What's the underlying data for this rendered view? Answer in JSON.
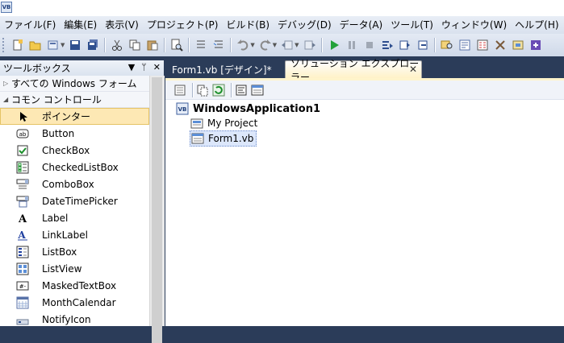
{
  "menubar": {
    "items": [
      "ファイル(F)",
      "編集(E)",
      "表示(V)",
      "プロジェクト(P)",
      "ビルド(B)",
      "デバッグ(D)",
      "データ(A)",
      "ツール(T)",
      "ウィンドウ(W)",
      "ヘルプ(H)"
    ]
  },
  "toolbox": {
    "title": "ツールボックス",
    "groups": [
      {
        "label": "すべての Windows フォーム",
        "expanded": false
      },
      {
        "label": "コモン コントロール",
        "expanded": true
      }
    ],
    "items": [
      {
        "label": "ポインター",
        "icon": "pointer-icon",
        "selected": true
      },
      {
        "label": "Button",
        "icon": "button-icon"
      },
      {
        "label": "CheckBox",
        "icon": "checkbox-icon"
      },
      {
        "label": "CheckedListBox",
        "icon": "checkedlistbox-icon"
      },
      {
        "label": "ComboBox",
        "icon": "combobox-icon"
      },
      {
        "label": "DateTimePicker",
        "icon": "datetimepicker-icon"
      },
      {
        "label": "Label",
        "icon": "label-icon"
      },
      {
        "label": "LinkLabel",
        "icon": "linklabel-icon"
      },
      {
        "label": "ListBox",
        "icon": "listbox-icon"
      },
      {
        "label": "ListView",
        "icon": "listview-icon"
      },
      {
        "label": "MaskedTextBox",
        "icon": "maskedtextbox-icon"
      },
      {
        "label": "MonthCalendar",
        "icon": "monthcalendar-icon"
      },
      {
        "label": "NotifyIcon",
        "icon": "notifyicon-icon"
      }
    ]
  },
  "tabs": {
    "design": "Form1.vb [デザイン]*",
    "solution": "ソリューション エクスプローラー"
  },
  "solution": {
    "root": "WindowsApplication1",
    "my_project": "My Project",
    "form": "Form1.vb"
  },
  "colors": {
    "background": "#2b3c59",
    "selection": "#fde8b4",
    "active_tab": "#fff2c7"
  }
}
